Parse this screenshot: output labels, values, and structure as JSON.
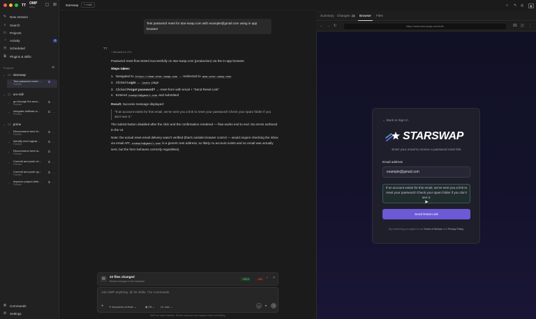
{
  "app": {
    "badge": "TT",
    "name": "OMP",
    "subtitle": "online"
  },
  "sidebar": {
    "nav": [
      {
        "label": "New session",
        "icon": "edit-icon"
      },
      {
        "label": "Search",
        "icon": "search-icon"
      },
      {
        "label": "Projects",
        "icon": "folder-icon"
      },
      {
        "label": "Activity",
        "icon": "activity-icon",
        "badge": "1"
      },
      {
        "label": "Scheduled",
        "icon": "clock-icon"
      },
      {
        "label": "Plugins & skills",
        "icon": "plugin-icon"
      }
    ],
    "section_label": "Projects",
    "projects": [
      {
        "name": "starswap",
        "threads": [
          {
            "title": "Test password reset ...",
            "status": "Finished",
            "active": true
          }
        ]
      },
      {
        "name": "om-mill",
        "threads": [
          {
            "title": "go through the acco...",
            "status": "Finished"
          },
          {
            "title": "integrate dotflask w...",
            "status": "Finished"
          }
        ]
      },
      {
        "name": "prime",
        "threads": [
          {
            "title": "Recommend next th...",
            "status": "Finished"
          },
          {
            "title": "Identify next logical ...",
            "status": "Finished"
          },
          {
            "title": "Recommend next ta...",
            "status": "Finished"
          },
          {
            "title": "Commit and push ch...",
            "status": "Finished"
          },
          {
            "title": "Commit and push qu...",
            "status": "Finished"
          },
          {
            "title": "Improve project dele...",
            "status": "Finished"
          }
        ]
      }
    ],
    "bottom": [
      {
        "label": "Commands",
        "icon": "command-icon"
      },
      {
        "label": "Settings",
        "icon": "gear-icon"
      }
    ]
  },
  "topbar": {
    "crumb": "starswap",
    "branch": "main"
  },
  "chat": {
    "user_message": "Test password reset for star-swap.com with example@gmail.com using in app browser",
    "avatar": "TT",
    "worked_for": "Worked for 17s",
    "summary": "Password reset flow tested successfully on star-swap.com (production) via the in-app browser.",
    "steps_heading": "Steps taken:",
    "steps": [
      {
        "n": "1.",
        "pre": "Navigated to ",
        "code": "https://www.star-swap.com",
        "mid": " → redirected to ",
        "code2": "www.star-swap.com"
      },
      {
        "n": "2.",
        "pre": "Clicked ",
        "bold": "Login",
        "mid": " → ",
        "code": "/auth",
        "post": " page"
      },
      {
        "n": "3.",
        "pre": "Clicked ",
        "bold": "Forgot password?",
        "post": " → reset form with email + \"Send Reset Link\""
      },
      {
        "n": "4.",
        "pre": "Entered ",
        "code": "example@gmail.com",
        "post": " and submitted"
      }
    ],
    "result_label": "Result:",
    "result_text": " Success message displayed:",
    "quote": "\"If an account exists for this email, we've sent you a link to reset your password! Check your spam folder if you don't see it.\"",
    "para2": "The submit button disabled after the click and the confirmation rendered — flow works end to end. No errors surfaced in the UI.",
    "para3_pre": "Note: the actual reset email delivery wasn't verified (that's outside browser control — would require checking the inbox via email API; ",
    "para3_code": "example@gmail.com",
    "para3_post": " is a generic test address, so likely no account exists and no email was actually sent, but the form behaves correctly regardless)."
  },
  "files_changed": {
    "title": "23 files changed",
    "subtitle": "Review changes in the inspector",
    "added": "+3019",
    "removed": "-291"
  },
  "composer": {
    "placeholder": "Ask OMP anything, @ for skills, / for commands",
    "model": "deepseek-v4-flash",
    "mode": "Off",
    "ui": "UI: max"
  },
  "footnote": "OMP can make mistakes. Review outcomes and changes before committing.",
  "rpanel": {
    "tabs": [
      "Summary",
      "Changes",
      "Browser",
      "Files"
    ],
    "changes_count": "23",
    "url": "https://www.star-swap.com/auth"
  },
  "reset_page": {
    "back": "Back to Sign In",
    "brand": "STARSWAP",
    "lead": "Enter your email to receive a password reset link.",
    "email_label": "Email address",
    "email_value": "example@gmail.com",
    "alert": "If an account exists for this email, we've sent you a link to reset your password! Check your spam folder if you don't see it.",
    "submit": "Send Reset Link",
    "terms_pre": "By continuing you agree to our ",
    "terms_link": "Terms of Service",
    "terms_and": " and ",
    "privacy_link": "Privacy Policy",
    "terms_post": "."
  },
  "colors": {
    "accent": "#6b5ad6",
    "alert_bg": "#1f2d2c",
    "add": "#6fd08a",
    "del": "#e06c75"
  }
}
